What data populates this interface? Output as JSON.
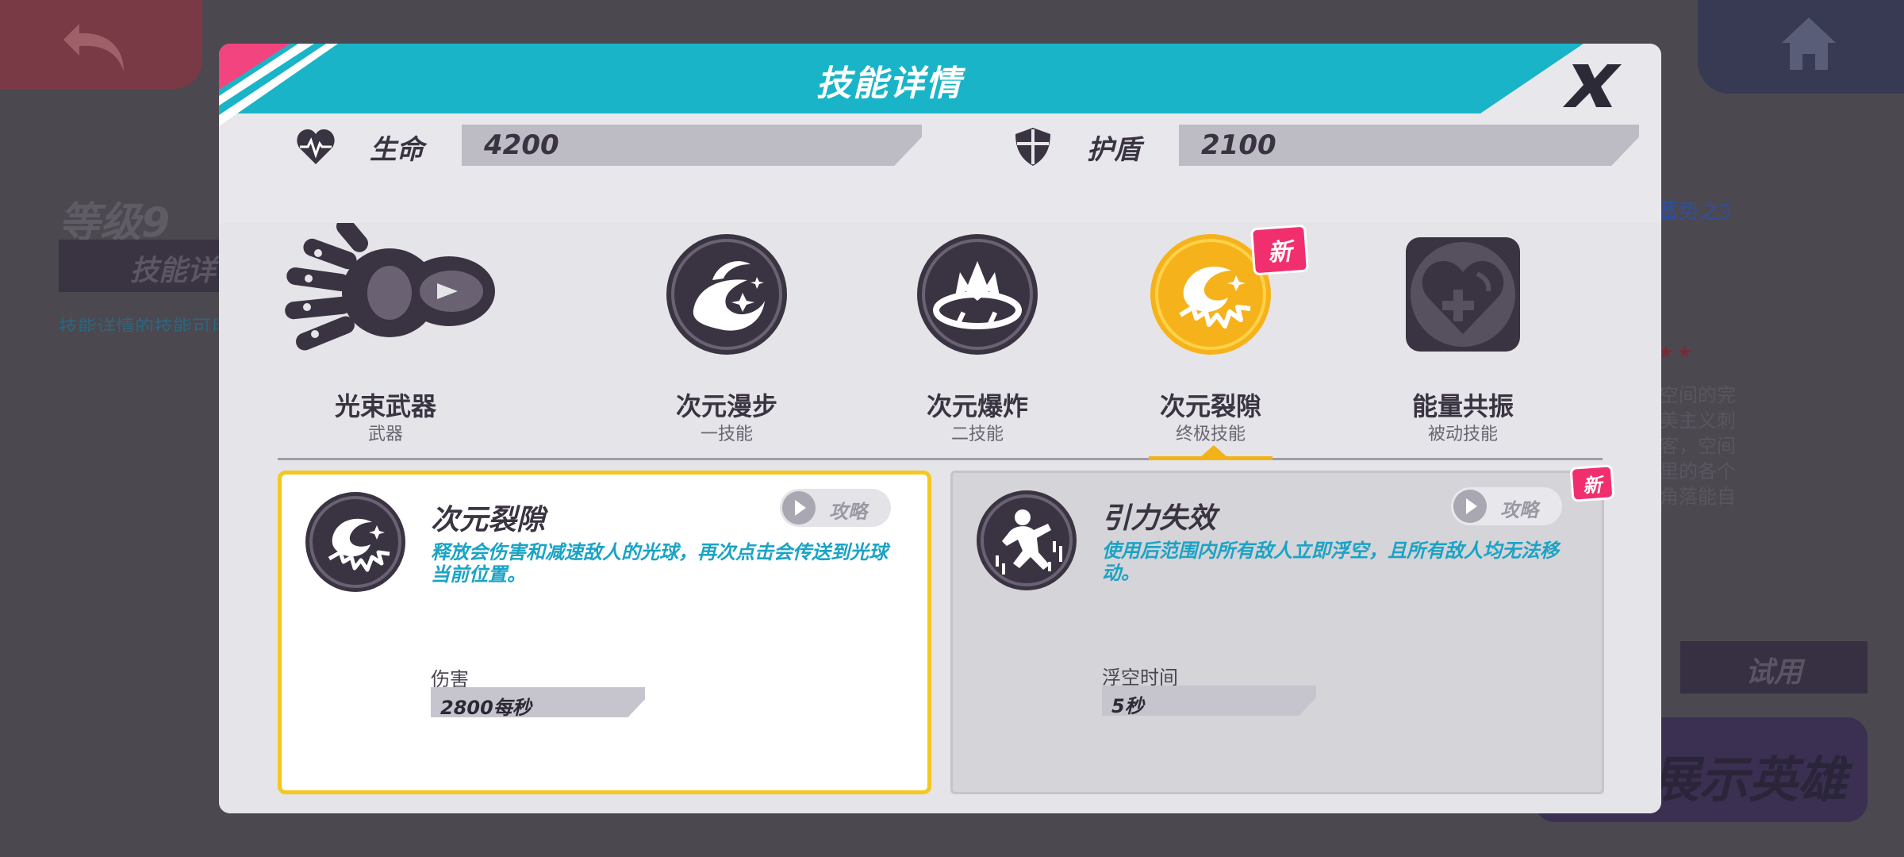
{
  "background": {
    "level_text": "等级9",
    "skill_button": "技能详情",
    "hint_text": "技能详情的技能可用",
    "right_title": "蓄势之灾",
    "right_text": "空间的完美主义刺客，空间里的各个角落能自己看不到的一，他的技能技巧多功能大多数行动。",
    "try_button": "试用",
    "show_hero_button": "展示英雄"
  },
  "modal": {
    "title": "技能详情",
    "close_label": "X"
  },
  "stats": {
    "hp": {
      "label": "生命",
      "value": "4200",
      "icon": "heart-pulse-icon"
    },
    "shield": {
      "label": "护盾",
      "value": "2100",
      "icon": "shield-icon"
    }
  },
  "skills": [
    {
      "name": "光束武器",
      "type": "武器",
      "icon": "beam-gauntlet-icon",
      "new": false
    },
    {
      "name": "次元漫步",
      "type": "一技能",
      "icon": "dimension-walk-icon",
      "new": false
    },
    {
      "name": "次元爆炸",
      "type": "二技能",
      "icon": "dimension-blast-icon",
      "new": false
    },
    {
      "name": "次元裂隙",
      "type": "终极技能",
      "icon": "dimension-rift-icon",
      "new": true,
      "selected": true
    },
    {
      "name": "能量共振",
      "type": "被动技能",
      "icon": "energy-resonance-icon",
      "new": false
    }
  ],
  "badge_new": "新",
  "cards": [
    {
      "title": "次元裂隙",
      "desc": "释放会伤害和减速敌人的光球，再次点击会传送到光球当前位置。",
      "guide_label": "攻略",
      "attr_label": "伤害",
      "attr_value": "2800每秒",
      "icon": "rift-orb-icon"
    },
    {
      "title": "引力失效",
      "desc": "使用后范围内所有敌人立即浮空，且所有敌人均无法移动。",
      "guide_label": "攻略",
      "attr_label": "浮空时间",
      "attr_value": "5秒",
      "icon": "gravity-loss-icon",
      "new": true
    }
  ],
  "colors": {
    "banner": "#1ab4c8",
    "accent_pink": "#f2447f",
    "selected_gold": "#f6c81e",
    "desc_text": "#1ba3c4",
    "icon_dark": "#3a3442"
  }
}
